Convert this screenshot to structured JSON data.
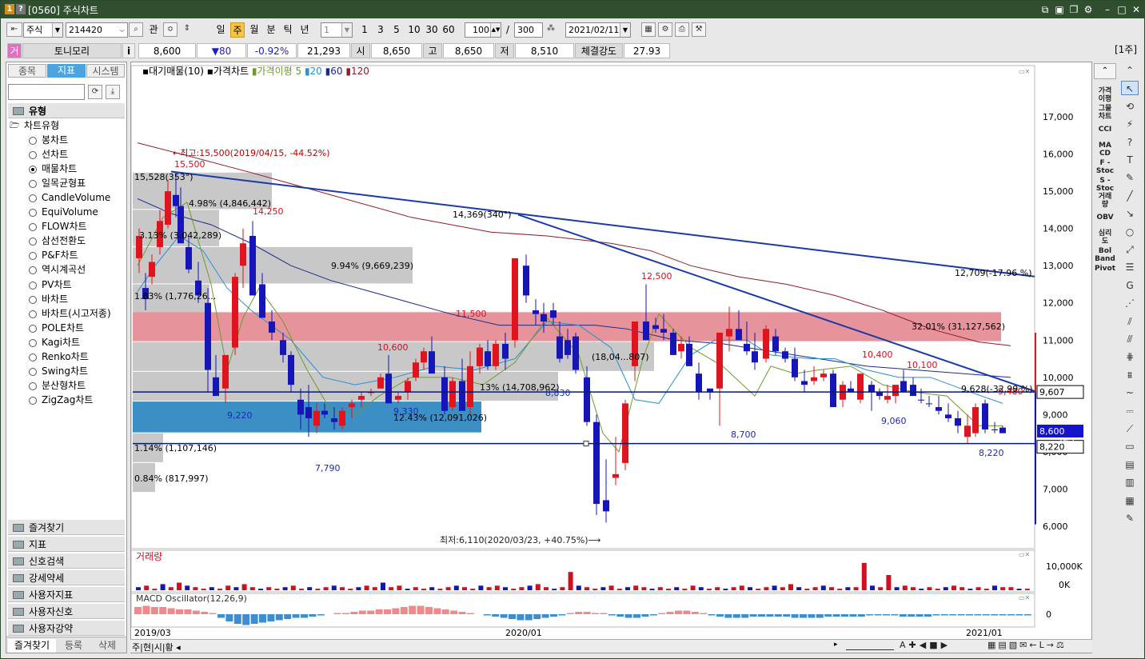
{
  "window": {
    "title": "[0560] 주식차트",
    "icon_num": "1",
    "icon_help": "?"
  },
  "toolbar": {
    "market": "주식",
    "code": "214420",
    "btn_gwan": "관",
    "periods": [
      "일",
      "주",
      "월",
      "분",
      "틱",
      "년"
    ],
    "interval_value": "1",
    "quick_intervals": [
      "1",
      "3",
      "5",
      "10",
      "30",
      "60"
    ],
    "count": "100",
    "count_total": "300",
    "date": "2021/02/11"
  },
  "quote": {
    "badge": "거",
    "name": "토니모리",
    "info_btn": "i",
    "price": "8,600",
    "change": "▼80",
    "change_pct": "-0.92%",
    "volume": "21,293",
    "open_label": "시",
    "open": "8,650",
    "high_label": "고",
    "high": "8,650",
    "low_label": "저",
    "low": "8,510",
    "strength_label": "체결강도",
    "strength": "27.93",
    "week_tag": "[1주]"
  },
  "left_tabs": [
    "종목",
    "지표",
    "시스템"
  ],
  "section_title": "유형",
  "tree_parent": "차트유형",
  "chart_types": [
    {
      "label": "봉차트",
      "on": false
    },
    {
      "label": "선차트",
      "on": false
    },
    {
      "label": "매물차트",
      "on": true
    },
    {
      "label": "일목균형표",
      "on": false
    },
    {
      "label": "CandleVolume",
      "on": false
    },
    {
      "label": "EquiVolume",
      "on": false
    },
    {
      "label": "FLOW차트",
      "on": false
    },
    {
      "label": "삼선전환도",
      "on": false
    },
    {
      "label": "P&F차트",
      "on": false
    },
    {
      "label": "역시계곡선",
      "on": false
    },
    {
      "label": "PV차트",
      "on": false
    },
    {
      "label": "바차트",
      "on": false
    },
    {
      "label": "바차트(시고저종)",
      "on": false
    },
    {
      "label": "POLE차트",
      "on": false
    },
    {
      "label": "Kagi차트",
      "on": false
    },
    {
      "label": "Renko차트",
      "on": false
    },
    {
      "label": "Swing차트",
      "on": false
    },
    {
      "label": "분산형차트",
      "on": false
    },
    {
      "label": "ZigZag차트",
      "on": false
    }
  ],
  "folders": [
    "즐겨찾기",
    "지표",
    "신호검색",
    "강세약세",
    "사용자지표",
    "사용자신호",
    "사용자강약"
  ],
  "bottom_tabs": [
    "즐겨찾기",
    "등록",
    "삭제"
  ],
  "legend": {
    "vp": "대기매물(10)",
    "price": "가격차트",
    "ma_label": "가격이평",
    "ma5": "5",
    "ma20": "20",
    "ma60": "60",
    "ma120": "120"
  },
  "volume_pane": {
    "title": "거래량",
    "ticks": [
      "10,000K",
      "0K"
    ]
  },
  "macd_pane": {
    "title": "MACD Oscillator(12,26,9)",
    "tick": "0"
  },
  "x_labels": [
    "2019/03",
    "2020/01",
    "2021/01"
  ],
  "y_ticks": [
    "17,000",
    "16,000",
    "15,000",
    "14,000",
    "13,000",
    "12,000",
    "11,000",
    "10,000",
    "9,000",
    "8,000",
    "7,000",
    "6,000"
  ],
  "price_tags": {
    "cur_line": "9,607",
    "last": "8,600",
    "support": "8,220"
  },
  "annotations": {
    "high": "←최고:15,500(2019/04/15, -44.52%)",
    "low": "최저:6,110(2020/03/23, +40.75%)⟶",
    "t1": "15,528(353°)",
    "t2": "14,369(340°)",
    "t3": "12,709(-17.96 %)",
    "t4": "9,628(-32.99 %)",
    "t5": "9,480",
    "t6": "2%)"
  },
  "vp_labels": [
    "4.98% (4,846,442)",
    "3.13% (3,042,289)",
    "9.94% (9,669,239)",
    "1.83% (1,776,26...",
    "32.01% (31,127,562)",
    "(18,04...807)",
    "13% (14,708,962)",
    "12.43% (12,091,026)",
    "1.14% (1,107,146)",
    "0.84% (817,997)"
  ],
  "peak_labels": [
    "15,500",
    "14,250",
    "10,600",
    "11,500",
    "12,500",
    "10,400",
    "10,100",
    "9,220",
    "9,330",
    "8,830",
    "7,790",
    "8,700",
    "9,060",
    "8,220"
  ],
  "bottom_left": [
    "주",
    "현",
    "시",
    "황"
  ]
}
